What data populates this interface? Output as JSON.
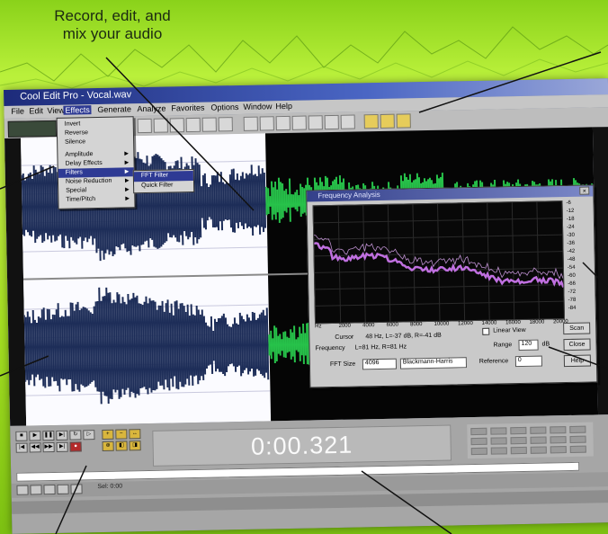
{
  "promo": {
    "caption_line1": "Record, edit, and",
    "caption_line2": "mix your audio"
  },
  "window": {
    "title": "Cool Edit Pro - Vocal.wav",
    "menu": [
      "File",
      "Edit",
      "View",
      "Effects",
      "Generate",
      "Analyze",
      "Favorites",
      "Options",
      "Window",
      "Help"
    ]
  },
  "effects_menu": {
    "items": [
      {
        "label": "Invert",
        "arrow": false
      },
      {
        "label": "Reverse",
        "arrow": false
      },
      {
        "label": "Silence",
        "arrow": false
      },
      {
        "label": "Amplitude",
        "arrow": true
      },
      {
        "label": "Delay Effects",
        "arrow": true
      },
      {
        "label": "Filters",
        "arrow": true
      },
      {
        "label": "Noise Reduction",
        "arrow": true
      },
      {
        "label": "Special",
        "arrow": true
      },
      {
        "label": "Time/Pitch",
        "arrow": true
      }
    ],
    "selected_index": 5,
    "submenu": [
      "FFT Filter",
      "Quick Filter"
    ]
  },
  "analysis_dialog": {
    "title": "Frequency Analysis",
    "close_glyph": "×",
    "y_ticks": [
      "-6",
      "-12",
      "-18",
      "-24",
      "-30",
      "-36",
      "-42",
      "-48",
      "-54",
      "-60",
      "-66",
      "-72",
      "-78",
      "-84"
    ],
    "x_ticks": [
      "Hz",
      "2000",
      "4000",
      "6000",
      "8000",
      "10000",
      "12000",
      "14000",
      "16000",
      "18000",
      "20000"
    ],
    "cursor_label": "Cursor",
    "cursor_value": "48 Hz, L=-37 dB, R=-41 dB",
    "frequency_label": "Frequency",
    "frequency_value": "L=81 Hz, R=81 Hz",
    "fft_size_label": "FFT Size",
    "fft_size_value": "4096",
    "window_value": "Blackmann-Harris",
    "linear_view_label": "Linear View",
    "range_label": "Range",
    "range_value": "120",
    "range_unit": "dB",
    "reference_label": "Reference",
    "reference_value": "0",
    "buttons": {
      "scan": "Scan",
      "close": "Close",
      "help": "Help"
    }
  },
  "transport": {
    "time": "0:00.321",
    "selection_label": "Sel: 0:00"
  }
}
